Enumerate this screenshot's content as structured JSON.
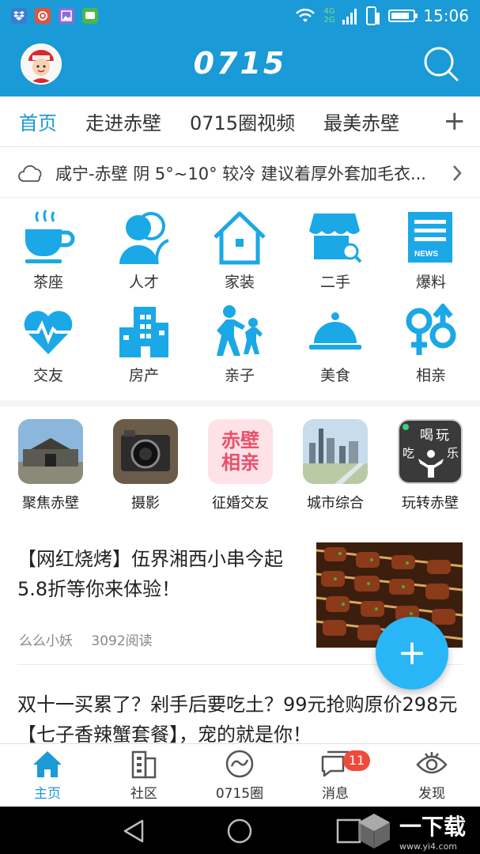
{
  "status_bar": {
    "time": "15:06",
    "network": "4G 2G",
    "battery_level": 0.85,
    "apps": [
      "dropbox",
      "camera",
      "gallery",
      "chat"
    ]
  },
  "header": {
    "logo_text": "0715",
    "avatar_icon": "avatar-mascot-icon",
    "search_icon": "search-icon",
    "brand_color": "#1a9ad6"
  },
  "tabs": {
    "items": [
      {
        "label": "首页",
        "active": true
      },
      {
        "label": "走进赤壁",
        "active": false
      },
      {
        "label": "0715圈视频",
        "active": false
      },
      {
        "label": "最美赤壁",
        "active": false
      }
    ],
    "add_label": "+"
  },
  "weather": {
    "icon": "cloud-icon",
    "text": "咸宁-赤壁 阴 5°~10° 较冷 建议着厚外套加毛衣..."
  },
  "categories": [
    {
      "label": "茶座",
      "icon": "teacup-icon"
    },
    {
      "label": "人才",
      "icon": "people-icon"
    },
    {
      "label": "家装",
      "icon": "house-icon"
    },
    {
      "label": "二手",
      "icon": "shop-icon"
    },
    {
      "label": "爆料",
      "icon": "news-icon",
      "icon_text": "NEWS"
    },
    {
      "label": "交友",
      "icon": "heart-pulse-icon"
    },
    {
      "label": "房产",
      "icon": "building-icon"
    },
    {
      "label": "亲子",
      "icon": "parent-child-icon"
    },
    {
      "label": "美食",
      "icon": "cloche-icon"
    },
    {
      "label": "相亲",
      "icon": "gender-icon"
    }
  ],
  "circles": [
    {
      "label": "聚焦赤壁",
      "icon": "city-gate-photo"
    },
    {
      "label": "摄影",
      "icon": "camera-photo"
    },
    {
      "label": "征婚交友",
      "icon": "dating-logo",
      "logo_text": [
        "赤壁",
        "相亲"
      ]
    },
    {
      "label": "城市综合",
      "icon": "skyline-photo"
    },
    {
      "label": "玩转赤壁",
      "icon": "fun-logo",
      "logo_text": [
        "喝",
        "玩",
        "吃",
        "乐"
      ]
    }
  ],
  "articles": [
    {
      "title": "【网红烧烤】伍界湘西小串今起5.8折等你来体验！",
      "author": "么么小妖",
      "reads": "3092阅读",
      "image_icon": "bbq-skewers-photo"
    },
    {
      "title": "双十一买累了？剁手后要吃土？99元抢购原价298元【七子香辣蟹套餐】，宠的就是你！"
    }
  ],
  "fab": {
    "label": "+"
  },
  "bottom_nav": {
    "items": [
      {
        "label": "主页",
        "icon": "home-icon",
        "active": true
      },
      {
        "label": "社区",
        "icon": "community-icon",
        "active": false
      },
      {
        "label": "0715圈",
        "icon": "circle-logo-icon",
        "active": false
      },
      {
        "label": "消息",
        "icon": "message-icon",
        "active": false,
        "badge": "11"
      },
      {
        "label": "发现",
        "icon": "eye-icon",
        "active": false
      }
    ]
  },
  "watermark": {
    "title": "一下载",
    "url": "www.yi4.com"
  }
}
